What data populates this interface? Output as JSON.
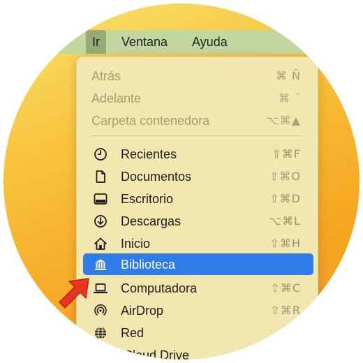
{
  "menubar": {
    "items": [
      {
        "label": "Ir"
      },
      {
        "label": "Ventana"
      },
      {
        "label": "Ayuda"
      }
    ]
  },
  "menu": {
    "disabled_items": [
      {
        "label": "Atrás",
        "shortcut": "⌘ Ñ"
      },
      {
        "label": "Adelante",
        "shortcut": "⌘ ´"
      },
      {
        "label": "Carpeta contenedora",
        "shortcut": "⌥⌘▲"
      }
    ],
    "items": [
      {
        "label": "Recientes",
        "shortcut": "⇧⌘F",
        "icon": "clock-icon"
      },
      {
        "label": "Documentos",
        "shortcut": "⇧⌘O",
        "icon": "document-icon"
      },
      {
        "label": "Escritorio",
        "shortcut": "⇧⌘D",
        "icon": "desktop-icon"
      },
      {
        "label": "Descargas",
        "shortcut": "⌥⌘L",
        "icon": "download-icon"
      },
      {
        "label": "Inicio",
        "shortcut": "⇧⌘H",
        "icon": "home-icon"
      },
      {
        "label": "Biblioteca",
        "shortcut": "",
        "icon": "library-icon",
        "highlighted": true
      },
      {
        "label": "Computadora",
        "shortcut": "⇧⌘C",
        "icon": "laptop-icon"
      },
      {
        "label": "AirDrop",
        "shortcut": "⇧⌘R",
        "icon": "airdrop-icon"
      },
      {
        "label": "Red",
        "shortcut": "⇧⌘",
        "icon": "network-icon"
      },
      {
        "label": "iCloud Drive",
        "shortcut": "",
        "icon": "icloud-icon"
      }
    ]
  },
  "colors": {
    "highlight": "#2f7be8",
    "menu_background": "#f2e7ae",
    "menubar_background": "#c4d6a0",
    "arrow": "#e8361e"
  }
}
